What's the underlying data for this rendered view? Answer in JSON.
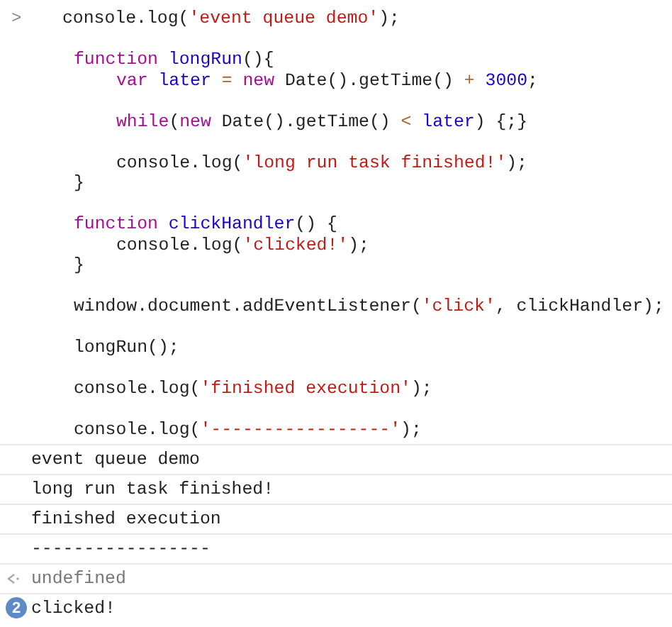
{
  "input": {
    "prompt": ">",
    "lines": [
      {
        "blank_before": false,
        "tokens": [
          {
            "kind": "plain",
            "text": "console.log("
          },
          {
            "kind": "string",
            "text": "'event queue demo'"
          },
          {
            "kind": "plain",
            "text": ");"
          }
        ]
      },
      {
        "blank_before": true,
        "tokens": [
          {
            "kind": "keyword",
            "text": "function "
          },
          {
            "kind": "name",
            "text": "longRun"
          },
          {
            "kind": "plain",
            "text": "(){"
          }
        ],
        "children": [
          {
            "blank_before": false,
            "tokens": [
              {
                "kind": "keyword",
                "text": "var "
              },
              {
                "kind": "name",
                "text": "later "
              },
              {
                "kind": "operator",
                "text": "= "
              },
              {
                "kind": "keyword",
                "text": "new "
              },
              {
                "kind": "plain",
                "text": "Date().getTime() "
              },
              {
                "kind": "operator",
                "text": "+ "
              },
              {
                "kind": "number",
                "text": "3000"
              },
              {
                "kind": "plain",
                "text": ";"
              }
            ]
          },
          {
            "blank_before": true,
            "tokens": [
              {
                "kind": "keyword",
                "text": "while"
              },
              {
                "kind": "plain",
                "text": "("
              },
              {
                "kind": "keyword",
                "text": "new "
              },
              {
                "kind": "plain",
                "text": "Date().getTime() "
              },
              {
                "kind": "operator",
                "text": "< "
              },
              {
                "kind": "name",
                "text": "later"
              },
              {
                "kind": "plain",
                "text": ") {;}"
              }
            ]
          },
          {
            "blank_before": true,
            "tokens": [
              {
                "kind": "plain",
                "text": "console.log("
              },
              {
                "kind": "string",
                "text": "'long run task finished!'"
              },
              {
                "kind": "plain",
                "text": ");"
              }
            ]
          }
        ]
      },
      {
        "blank_before": false,
        "tokens": [
          {
            "kind": "plain",
            "text": "}"
          }
        ]
      },
      {
        "blank_before": true,
        "tokens": [
          {
            "kind": "keyword",
            "text": "function "
          },
          {
            "kind": "name",
            "text": "clickHandler"
          },
          {
            "kind": "plain",
            "text": "() {"
          }
        ],
        "children": [
          {
            "blank_before": false,
            "tokens": [
              {
                "kind": "plain",
                "text": "console.log("
              },
              {
                "kind": "string",
                "text": "'clicked!'"
              },
              {
                "kind": "plain",
                "text": ");"
              }
            ]
          }
        ]
      },
      {
        "blank_before": false,
        "tokens": [
          {
            "kind": "plain",
            "text": "}"
          }
        ]
      },
      {
        "blank_before": true,
        "tokens": [
          {
            "kind": "plain",
            "text": "window.document.addEventListener("
          },
          {
            "kind": "string",
            "text": "'click'"
          },
          {
            "kind": "plain",
            "text": ", clickHandler);"
          }
        ]
      },
      {
        "blank_before": true,
        "tokens": [
          {
            "kind": "plain",
            "text": "longRun();"
          }
        ]
      },
      {
        "blank_before": true,
        "tokens": [
          {
            "kind": "plain",
            "text": "console.log("
          },
          {
            "kind": "string",
            "text": "'finished execution'"
          },
          {
            "kind": "plain",
            "text": ");"
          }
        ]
      },
      {
        "blank_before": true,
        "tokens": [
          {
            "kind": "plain",
            "text": "console.log("
          },
          {
            "kind": "string",
            "text": "'-----------------'"
          },
          {
            "kind": "plain",
            "text": ");"
          }
        ]
      }
    ]
  },
  "output": [
    {
      "kind": "log",
      "text": "event queue demo"
    },
    {
      "kind": "log",
      "text": "long run task finished!"
    },
    {
      "kind": "log",
      "text": "finished execution"
    },
    {
      "kind": "log",
      "text": "-----------------"
    },
    {
      "kind": "result",
      "text": "undefined"
    },
    {
      "kind": "repeated",
      "count": "2",
      "text": "clicked!"
    }
  ]
}
